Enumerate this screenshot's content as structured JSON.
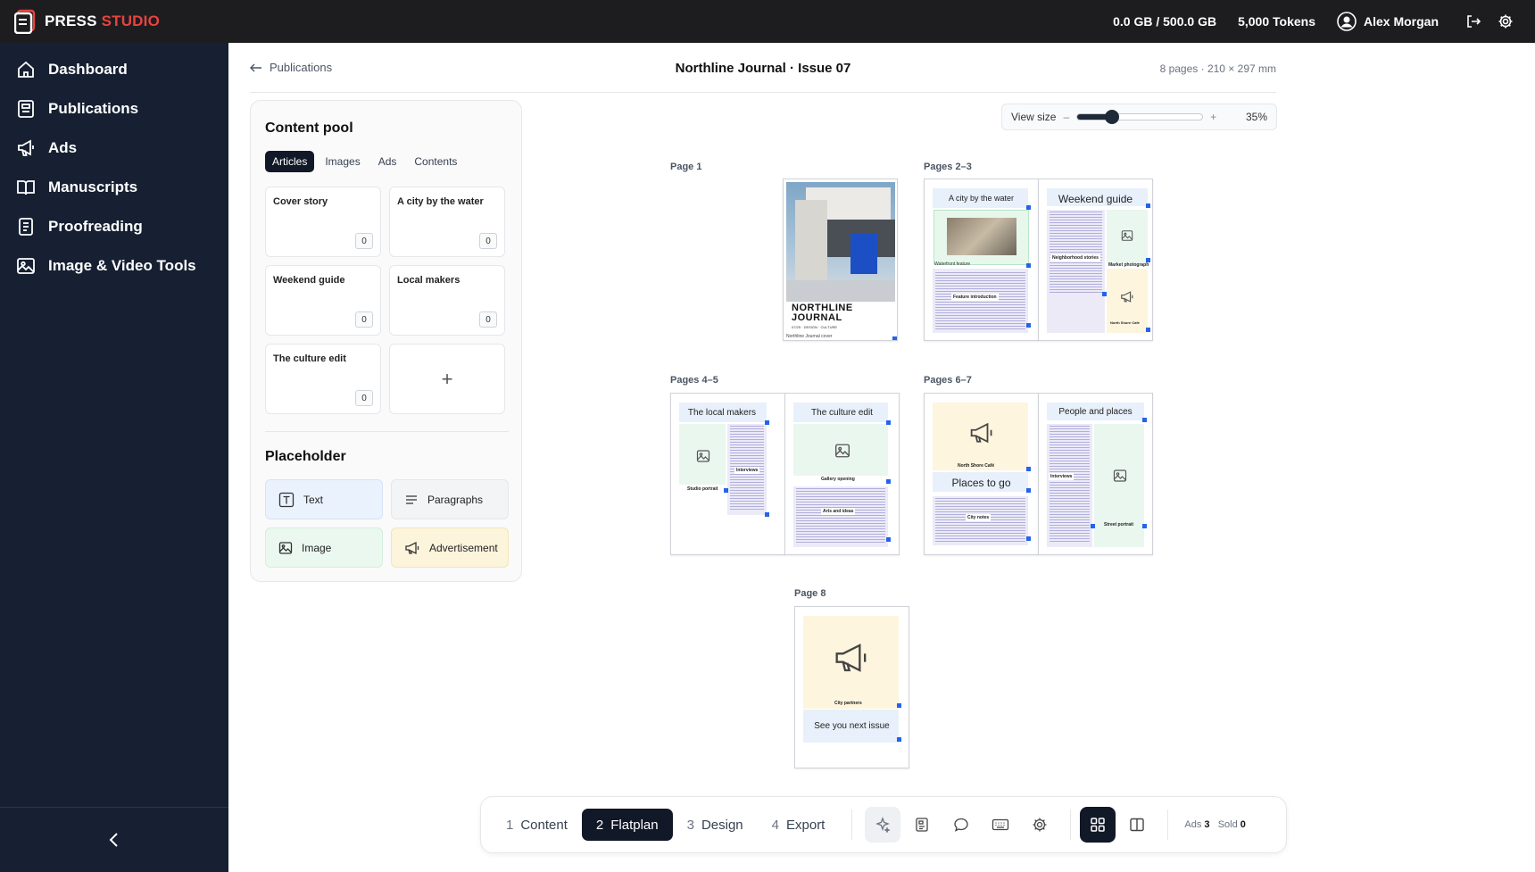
{
  "app": {
    "brand_a": "PRESS",
    "brand_b": "STUDIO"
  },
  "topbar": {
    "storage": "0.0 GB / 500.0 GB",
    "tokens": "5,000 Tokens",
    "user": "Alex Morgan"
  },
  "sidebar": {
    "items": [
      {
        "label": "Dashboard",
        "icon": "home-icon"
      },
      {
        "label": "Publications",
        "icon": "publication-icon"
      },
      {
        "label": "Ads",
        "icon": "megaphone-icon"
      },
      {
        "label": "Manuscripts",
        "icon": "book-icon"
      },
      {
        "label": "Proofreading",
        "icon": "document-icon"
      },
      {
        "label": "Image & Video Tools",
        "icon": "image-icon"
      }
    ]
  },
  "header": {
    "back": "Publications",
    "title": "Northline Journal · Issue 07",
    "meta": "8 pages · 210 × 297 mm"
  },
  "pool": {
    "title": "Content pool",
    "tabs": [
      "Articles",
      "Images",
      "Ads",
      "Contents"
    ],
    "cards": [
      {
        "title": "Cover story",
        "count": "0"
      },
      {
        "title": "A city by the water",
        "count": "0"
      },
      {
        "title": "Weekend guide",
        "count": "0"
      },
      {
        "title": "Local makers",
        "count": "0"
      },
      {
        "title": "The culture edit",
        "count": "0"
      }
    ],
    "add": "+"
  },
  "placeholder": {
    "title": "Placeholder",
    "items": [
      "Text",
      "Paragraphs",
      "Image",
      "Advertisement"
    ]
  },
  "viewsize": {
    "label": "View size",
    "minus": "–",
    "plus": "+",
    "value": 35,
    "value_label": "35%"
  },
  "spreads": {
    "p1": "Page 1",
    "p23": "Pages 2–3",
    "p45": "Pages 4–5",
    "p67": "Pages 6–7",
    "p8": "Page 8"
  },
  "pages": {
    "cover": {
      "masthead": "NORTHLINE\nJOURNAL",
      "sub": "07/25 · DESIGN · CULTURE",
      "caption": "Northline Journal cover"
    },
    "p2": {
      "heading": "A city by the water",
      "photo_caption": "Waterfront feature",
      "box": "Feature introduction"
    },
    "p3": {
      "heading": "Weekend guide",
      "c1": "Neighborhood stories",
      "c2": "Market photograph",
      "c3": "North Shore Café"
    },
    "p4": {
      "heading": "The local makers",
      "c1": "Interviews",
      "c2": "Studio portrait"
    },
    "p5": {
      "heading": "The culture edit",
      "c1": "Gallery opening",
      "c2": "Arts and ideas"
    },
    "p6": {
      "c1": "North Shore Café",
      "heading": "Places to go",
      "c2": "City notes"
    },
    "p7": {
      "heading": "People and places",
      "c1": "Interviews",
      "c2": "Street portrait"
    },
    "p8": {
      "c1": "City partners",
      "heading": "See you next issue"
    }
  },
  "toolbar": {
    "steps": [
      {
        "n": "1",
        "label": "Content"
      },
      {
        "n": "2",
        "label": "Flatplan"
      },
      {
        "n": "3",
        "label": "Design"
      },
      {
        "n": "4",
        "label": "Export"
      }
    ],
    "ads_label": "Ads",
    "ads": "3",
    "sold_label": "Sold",
    "sold": "0"
  },
  "colors": {
    "accent": "#e8433f",
    "sidebar": "#162032",
    "topbar": "#1d1d1f",
    "handle": "#2563eb"
  }
}
